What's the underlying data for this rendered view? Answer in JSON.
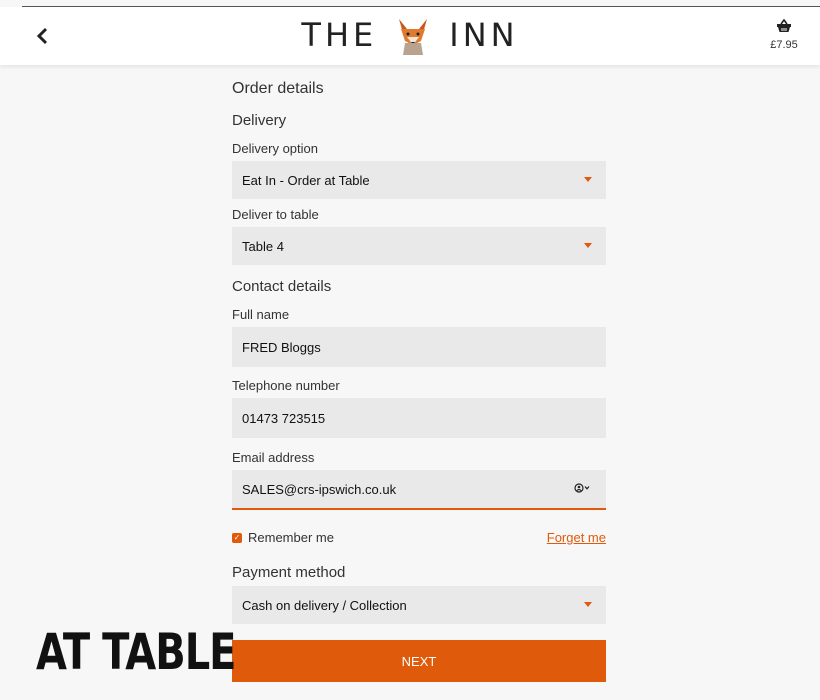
{
  "header": {
    "logo_left": "THE",
    "logo_right": "INN",
    "basket_price": "£7.95",
    "back_icon": "chevron-left-icon",
    "basket_icon": "basket-icon"
  },
  "form": {
    "title": "Order details",
    "delivery_heading": "Delivery",
    "delivery_option_label": "Delivery option",
    "delivery_option_value": "Eat In - Order at Table",
    "deliver_to_table_label": "Deliver to table",
    "deliver_to_table_value": "Table 4",
    "contact_heading": "Contact details",
    "full_name_label": "Full name",
    "full_name_value": "FRED Bloggs",
    "telephone_label": "Telephone number",
    "telephone_value": "01473 723515",
    "email_label": "Email address",
    "email_value": "SALES@crs-ipswich.co.uk",
    "remember_label": "Remember me",
    "forget_label": "Forget me",
    "payment_heading": "Payment method",
    "payment_value": "Cash on delivery / Collection",
    "next_label": "NEXT"
  },
  "overlay": {
    "caption": "AT TABLE"
  },
  "colors": {
    "accent": "#e05a0c",
    "field_bg": "#e9e9e9",
    "page_bg": "#f7f7f7"
  }
}
